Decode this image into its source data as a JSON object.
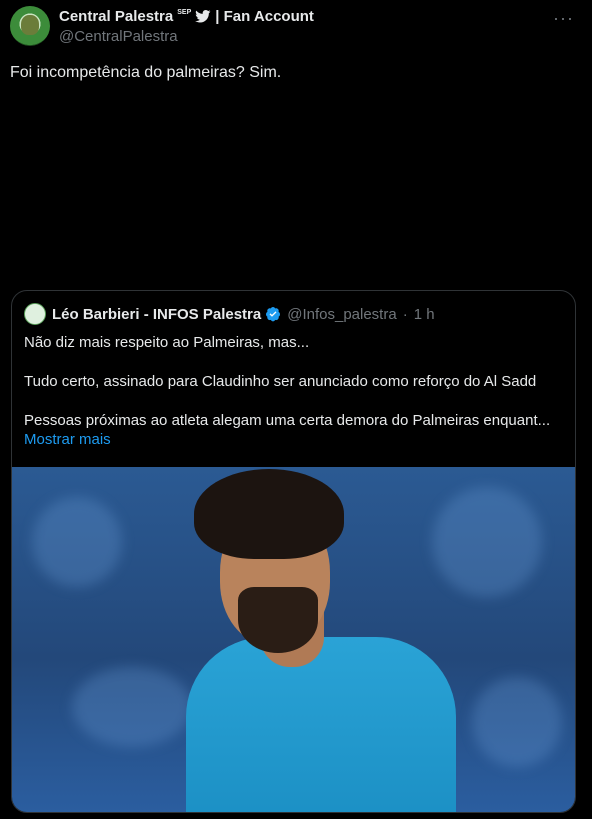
{
  "author": {
    "name": "Central Palestra",
    "superscript": "SEP",
    "suffix": "| Fan Account",
    "handle": "@CentralPalestra",
    "avatar_icon": "club-logo-avatar",
    "bird_icon": "twitter-bird-icon"
  },
  "more_label": "···",
  "tweet_text": "Foi incompetência do palmeiras? Sim.",
  "quoted": {
    "name": "Léo Barbieri - INFOS Palestra",
    "handle": "@Infos_palestra",
    "separator": "·",
    "time": "1 h",
    "lines": [
      "Não diz mais respeito ao Palmeiras, mas...",
      "Tudo certo, assinado para Claudinho ser anunciado como reforço do Al Sadd",
      "Pessoas próximas ao atleta alegam uma certa demora do Palmeiras enquant..."
    ],
    "show_more": "Mostrar mais"
  },
  "colors": {
    "background": "#000000",
    "text": "#e7e9ea",
    "muted": "#71767b",
    "link": "#1d9bf0",
    "border": "#2f3336",
    "verified": "#1d9bf0"
  }
}
